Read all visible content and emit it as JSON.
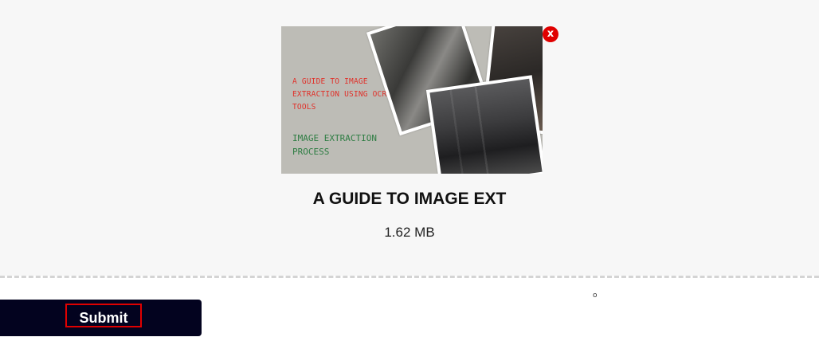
{
  "upload": {
    "thumbnail": {
      "title_red": "A GUIDE TO IMAGE EXTRACTION USING OCR TOOLS",
      "title_green": "IMAGE EXTRACTION PROCESS"
    },
    "remove_label": "x",
    "file_name": "A GUIDE TO IMAGE EXT",
    "file_size": "1.62 MB"
  },
  "footer": {
    "mark": "o",
    "submit_label": "Submit"
  },
  "colors": {
    "panel_bg": "#f7f7f7",
    "submit_bg": "#03031f",
    "remove_bg": "#e00000",
    "thumb_red_text": "#e0312a",
    "thumb_green_text": "#2e7d43"
  },
  "icons": {
    "remove": "close-icon"
  }
}
